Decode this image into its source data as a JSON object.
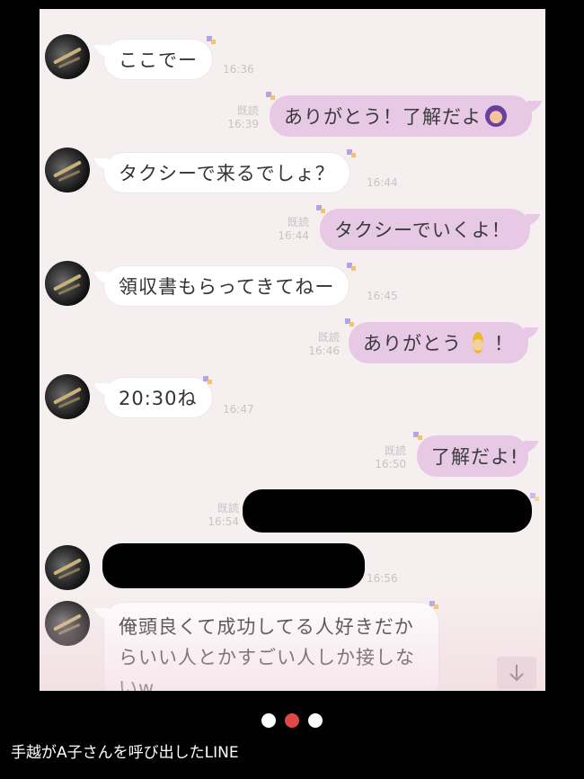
{
  "chat": {
    "messages": [
      {
        "side": "left",
        "text": "ここでー",
        "time": "16:36"
      },
      {
        "side": "right",
        "text": "ありがとう！了解だよ",
        "read": "既読",
        "time": "16:39",
        "emoji": "woman-gesturing-ok-icon"
      },
      {
        "side": "left",
        "text": "タクシーで来るでしょ？",
        "time": "16:44"
      },
      {
        "side": "right",
        "text": "タクシーでいくよ！",
        "read": "既読",
        "time": "16:44"
      },
      {
        "side": "left",
        "text": "領収書もらってきてねー",
        "time": "16:45"
      },
      {
        "side": "right",
        "text": "ありがとう",
        "text_after": "！",
        "read": "既読",
        "time": "16:46",
        "emoji": "princess-icon"
      },
      {
        "side": "left",
        "text": "20:30ね",
        "time": "16:47"
      },
      {
        "side": "right",
        "text": "了解だよ!",
        "read": "既読",
        "time": "16:50"
      },
      {
        "side": "right",
        "text": "",
        "read": "既読",
        "time": "16:54",
        "redacted": true
      },
      {
        "side": "left",
        "text": "",
        "time": "16:56",
        "redacted": true
      },
      {
        "side": "left",
        "text": "俺頭良くて成功してる人好きだからいい人とかすごい人しか接しないw",
        "time": ""
      }
    ],
    "scroll_down_icon": "arrow-down-icon",
    "colors": {
      "bg": "#f6efef",
      "right_bubble": "#e7c9e6",
      "left_bubble": "#ffffff"
    }
  },
  "carousel": {
    "dots": 3,
    "active_index": 1
  },
  "caption": "手越がA子さんを呼び出したLINE"
}
